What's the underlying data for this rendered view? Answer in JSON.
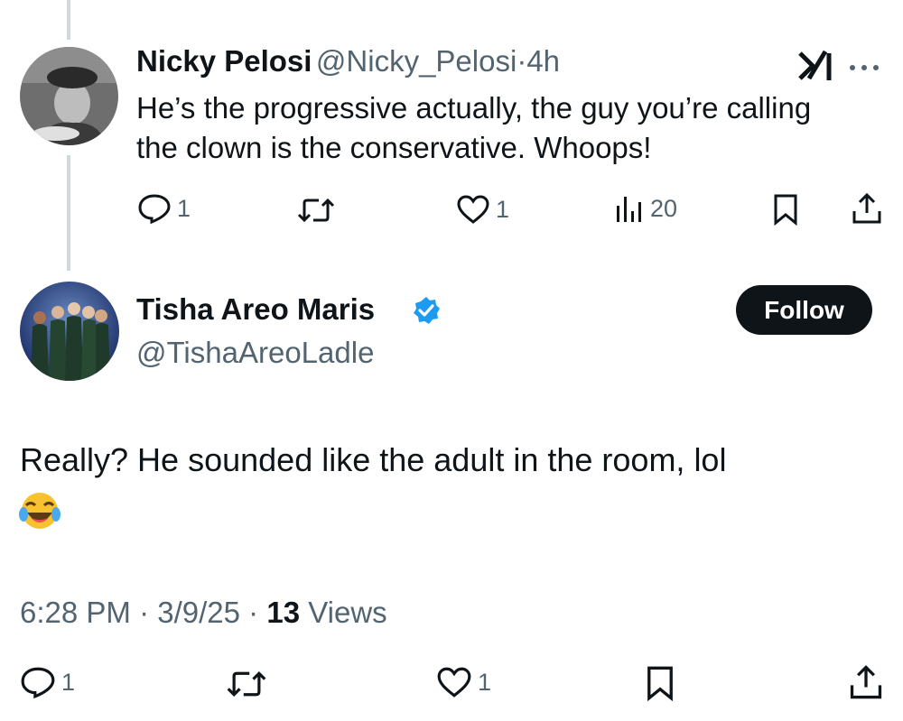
{
  "reply": {
    "name": "Nicky Pelosi",
    "handle": "@Nicky_Pelosi",
    "separator": "·",
    "time": "4h",
    "text": "He’s the progressive actually, the guy you’re calling the clown is the conservative. Whoops!",
    "counts": {
      "replies": "1",
      "likes": "1",
      "views": "20"
    },
    "grok_icon": "grok-logo-icon",
    "more_icon": "more-icon"
  },
  "main": {
    "name": "Tisha Areo Maris",
    "handle": "@TishaAreoLadle",
    "follow_label": "Follow",
    "text": "Really? He sounded like the adult in the room, lol",
    "emoji": "face-with-tears-of-joy",
    "time": "6:28 PM",
    "date": "3/9/25",
    "separator": "·",
    "views_count": "13",
    "views_label": "Views",
    "counts": {
      "replies": "1",
      "likes": "1"
    }
  },
  "colors": {
    "text": "#0f1419",
    "secondary": "#536471",
    "verified": "#1d9bf0",
    "button": "#0f1419"
  }
}
